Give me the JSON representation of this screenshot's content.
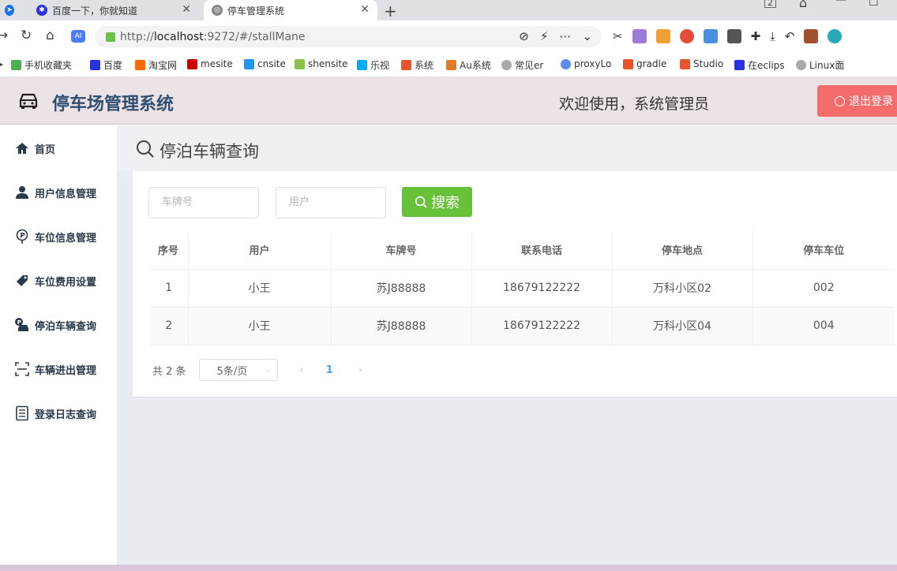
{
  "browser": {
    "tabs": [
      {
        "label": ""
      },
      {
        "label": "百度一下，你就知道"
      },
      {
        "label": "停车管理系统"
      }
    ],
    "url_scheme": "http://",
    "url_host": "localhost",
    "url_rest": ":9272/#/stallMane",
    "bookmarks": [
      "手机收藏夹",
      "百度",
      "淘宝网",
      "mesite",
      "cnsite",
      "shensite",
      "乐视",
      "系统",
      "Au系统",
      "常见er",
      "proxyLo",
      "gradle",
      "Studio",
      "在eclips",
      "Linux面"
    ]
  },
  "header": {
    "title": "停车场管理系统",
    "welcome": "欢迎使用，系统管理员",
    "logout_label": "退出登录"
  },
  "sidebar": {
    "items": [
      {
        "label": "首页",
        "icon": "home-icon"
      },
      {
        "label": "用户信息管理",
        "icon": "user-icon"
      },
      {
        "label": "车位信息管理",
        "icon": "parking-icon"
      },
      {
        "label": "车位费用设置",
        "icon": "tag-icon"
      },
      {
        "label": "停泊车辆查询",
        "icon": "parked-car-icon"
      },
      {
        "label": "车辆进出管理",
        "icon": "scan-icon"
      },
      {
        "label": "登录日志查询",
        "icon": "log-icon"
      }
    ]
  },
  "main": {
    "page_title": "停泊车辆查询",
    "plate_placeholder": "车牌号",
    "user_placeholder": "用户",
    "search_label": "搜索",
    "table": {
      "headers": [
        "序号",
        "用户",
        "车牌号",
        "联系电话",
        "停车地点",
        "停车车位"
      ],
      "rows": [
        [
          "1",
          "小王",
          "苏J88888",
          "18679122222",
          "万科小区02",
          "002"
        ],
        [
          "2",
          "小王",
          "苏J88888",
          "18679122222",
          "万科小区04",
          "004"
        ]
      ]
    },
    "pager": {
      "total": "共 2 条",
      "page_size": "5条/页",
      "current_page": "1"
    }
  },
  "colors": {
    "header_bg": "#ebe3e5",
    "title": "#2f4e70",
    "logout": "#f56c6c",
    "search": "#67c23a",
    "page_active": "#409eff"
  }
}
